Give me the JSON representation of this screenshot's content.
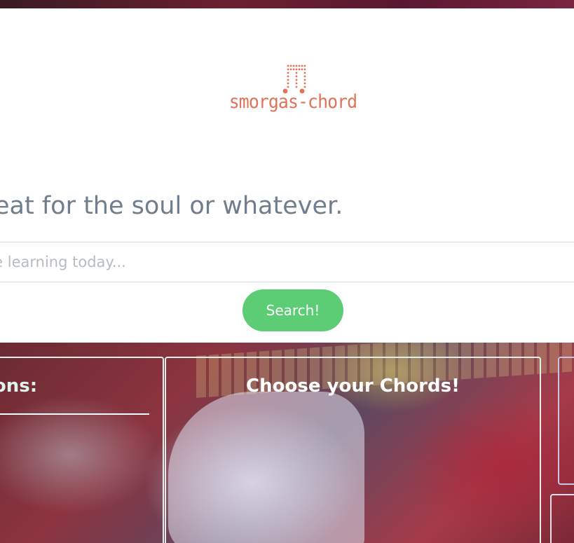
{
  "brand": {
    "name": "smorgas-chord",
    "color": "#e0735a"
  },
  "hero_text": {
    "tagline": "eat for the soul or whatever."
  },
  "search": {
    "placeholder": "we learning today...",
    "value": "",
    "button_label": "Search!",
    "button_color": "#5ccd74"
  },
  "panels": {
    "left_title": "ions:",
    "mid_title": "Choose your Chords!"
  },
  "icons": {
    "logo": "music-note-dots-icon"
  }
}
